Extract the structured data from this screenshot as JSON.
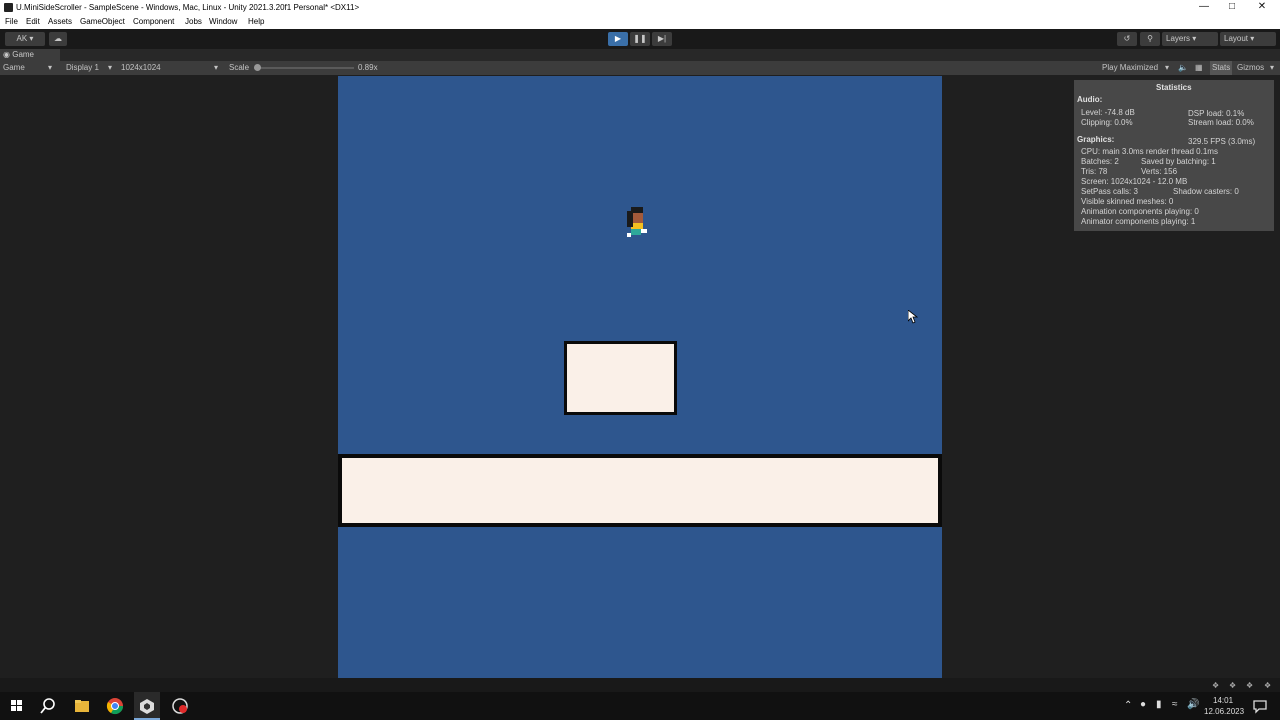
{
  "window": {
    "title": "U.MiniSideScroller - SampleScene - Windows, Mac, Linux - Unity 2021.3.20f1 Personal* <DX11>",
    "minimize": "—",
    "maximize": "□",
    "close": "✕"
  },
  "menu": [
    "File",
    "Edit",
    "Assets",
    "GameObject",
    "Component",
    "Jobs",
    "Window",
    "Help"
  ],
  "toolbar": {
    "account": "AK",
    "layers": "Layers",
    "layout": "Layout"
  },
  "game_tab": {
    "label": "Game"
  },
  "game_bar": {
    "view": "Game",
    "display": "Display 1",
    "resolution": "1024x1024",
    "scale_label": "Scale",
    "scale_value": "0.89x",
    "play_mode": "Play Maximized",
    "stats": "Stats",
    "gizmos": "Gizmos"
  },
  "stats": {
    "title": "Statistics",
    "audio_hdr": "Audio:",
    "level": "Level: -74.8 dB",
    "dsp": "DSP load: 0.1%",
    "clipping": "Clipping: 0.0%",
    "stream": "Stream load: 0.0%",
    "graphics_hdr": "Graphics:",
    "fps": "329.5 FPS (3.0ms)",
    "cpu": "CPU: main 3.0ms  render thread 0.1ms",
    "batches": "Batches: 2",
    "saved": "Saved by batching: 1",
    "tris": "Tris: 78",
    "verts": "Verts: 156",
    "screen": "Screen: 1024x1024 - 12.0 MB",
    "setpass": "SetPass calls: 3",
    "shadow": "Shadow casters: 0",
    "skinned": "Visible skinned meshes: 0",
    "anim": "Animation components playing: 0",
    "animator": "Animator components playing: 1"
  },
  "taskbar": {
    "time": "14:01",
    "date": "12.06.2023"
  },
  "colors": {
    "sky": "#2e568e",
    "platform": "#faf0e8",
    "outline": "#0a0a0a"
  }
}
